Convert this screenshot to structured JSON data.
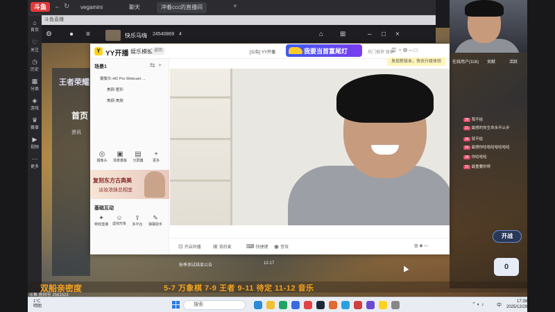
{
  "browser": {
    "logo": "斗鱼",
    "tabs": [
      {
        "label": "vegamini"
      },
      {
        "label": "聊天"
      },
      {
        "label": "冲着ccc的直播间"
      }
    ]
  },
  "client": {
    "title": "斗鱼直播"
  },
  "sidebar": {
    "items": [
      {
        "icon": "home-icon",
        "label": "首页"
      },
      {
        "icon": "follow-icon",
        "label": "关注"
      },
      {
        "icon": "history-icon",
        "label": "历史"
      },
      {
        "icon": "category-icon",
        "label": "分类"
      },
      {
        "icon": "game-icon",
        "label": "游戏"
      },
      {
        "icon": "match-icon",
        "label": "赛事"
      },
      {
        "icon": "video-icon",
        "label": "视频"
      },
      {
        "icon": "more-icon",
        "label": "更多"
      }
    ]
  },
  "live_bar": {
    "streamer": "快乐马嗨",
    "room_number": "24540869",
    "fans": "4"
  },
  "page": {
    "nav_home": "首页",
    "nav_news": "资讯",
    "brand": "王者荣耀"
  },
  "yy": {
    "logo_letter": "Y",
    "app_title": "YY开播",
    "mode": "娱乐模板",
    "switch": "返回",
    "notice": "[公告] YY开播",
    "banner": "我要当首富尾灯",
    "hot": "热门推荐 搜索",
    "tip": "发现新版本，快去升级体验",
    "scene": {
      "title": "场景1",
      "sources": [
        "摄像头-HD Pro Webcam ...",
        "美颜-整形",
        "美颜-美肤"
      ]
    },
    "tools": [
      {
        "icon": "camera-icon",
        "label": "摄像头"
      },
      {
        "icon": "layout-icon",
        "label": "场景模板"
      },
      {
        "icon": "window-icon",
        "label": "分屏器"
      },
      {
        "icon": "plus-icon",
        "label": "更多"
      }
    ],
    "ad": {
      "line1": "复刻东方古典美",
      "line2": "淡妆浓抹总相宜"
    },
    "interact": {
      "title": "基础互动",
      "items": [
        {
          "icon": "gift-icon",
          "label": "特效直播"
        },
        {
          "icon": "avatar-icon",
          "label": "虚拟形象"
        },
        {
          "icon": "share-icon",
          "label": "多平台"
        },
        {
          "icon": "assist-icon",
          "label": "弹幕助手"
        }
      ]
    },
    "footer": [
      {
        "icon": "record-icon",
        "label": "开启同播"
      },
      {
        "icon": "mic-icon",
        "label": "背后麦"
      },
      {
        "icon": "clip-icon",
        "label": "快捷键"
      },
      {
        "icon": "play-icon",
        "label": "音效"
      }
    ]
  },
  "chat": {
    "header": "在线用户(316)",
    "tab2": "贡献",
    "tab3": "活跃",
    "lines": [
      {
        "badge": "38",
        "text": "我不给"
      },
      {
        "badge": "31",
        "text": "最想的你生命永不止步"
      },
      {
        "badge": "38",
        "text": "就不给"
      },
      {
        "badge": "34",
        "text": "最想你哈哈哈哈哈哈哈"
      },
      {
        "badge": "38",
        "text": "你哈哈哈"
      },
      {
        "badge": "32",
        "text": "最重要的呀"
      }
    ]
  },
  "actions": {
    "start": "开战",
    "count": "0"
  },
  "bottom": {
    "schedule_a": "双船亲密度",
    "schedule_b": "5-7 万象棋 7-9 王者 9-11 待定 11-12 音乐",
    "room_id": "斗鱼 房间号 2561523",
    "ticker": "秋季测试结束公告",
    "ticker_date": "12-17"
  },
  "taskbar": {
    "weather_temp": "1°C",
    "weather_desc": "晴朗",
    "search_placeholder": "搜索",
    "time": "17:38",
    "date": "2025/12/29",
    "lang": "中"
  }
}
